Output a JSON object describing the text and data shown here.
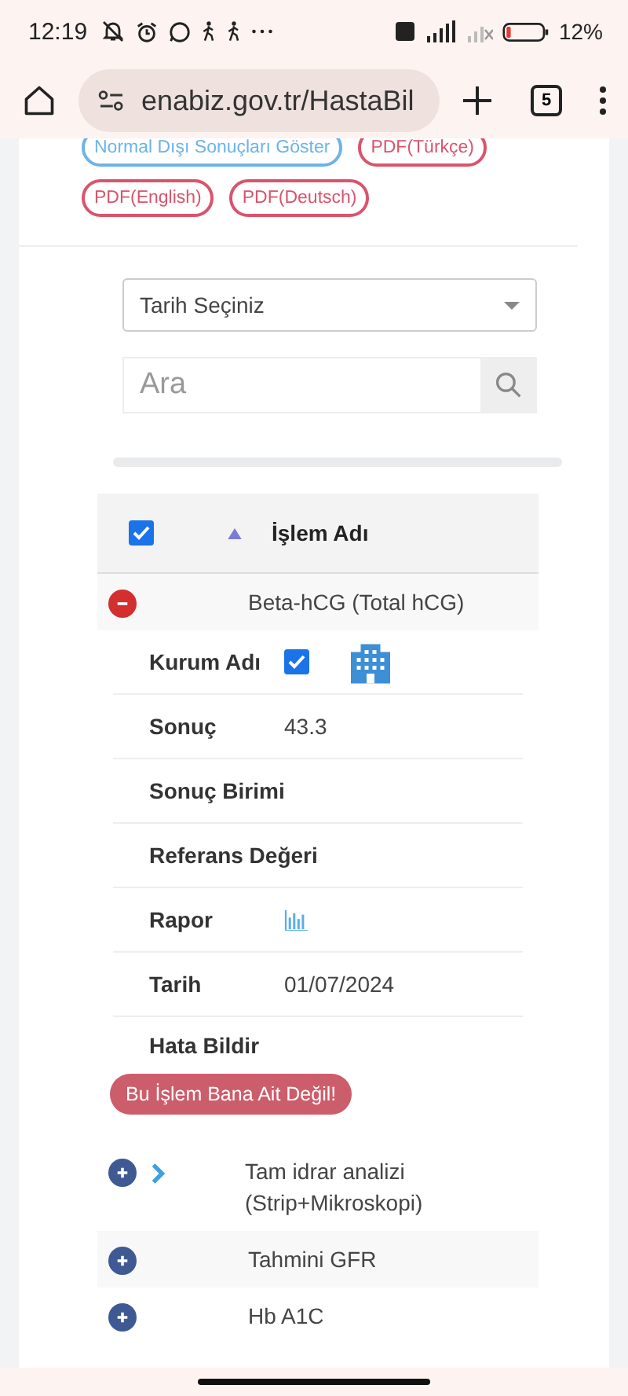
{
  "status_bar": {
    "time": "12:19",
    "battery": "12%"
  },
  "browser": {
    "url": "enabiz.gov.tr/HastaBil",
    "tab_count": "5"
  },
  "filter_buttons": [
    {
      "label": "Normal Dışı Sonuçları Göster",
      "kind": "blue"
    },
    {
      "label": "PDF(Türkçe)",
      "kind": "red"
    },
    {
      "label": "PDF(English)",
      "kind": "red"
    },
    {
      "label": "PDF(Deutsch)",
      "kind": "red"
    }
  ],
  "date_select": {
    "value": "Tarih Seçiniz"
  },
  "search": {
    "placeholder": "Ara"
  },
  "table": {
    "header": {
      "checked": true,
      "column": "İşlem Adı"
    },
    "rows": [
      {
        "name": "Beta-hCG (Total hCG)",
        "expanded": true,
        "chevron": false,
        "details": [
          {
            "kind": "institution",
            "label": "Kurum Adı",
            "checked": true
          },
          {
            "kind": "text",
            "label": "Sonuç",
            "value": "43.3"
          },
          {
            "kind": "text",
            "label": "Sonuç Birimi"
          },
          {
            "kind": "text",
            "label": "Referans Değeri"
          },
          {
            "kind": "report",
            "label": "Rapor"
          },
          {
            "kind": "text",
            "label": "Tarih",
            "value": "01/07/2024"
          },
          {
            "kind": "report_error",
            "label": "Hata Bildir",
            "button": "Bu İşlem Bana Ait Değil!"
          }
        ]
      },
      {
        "name": "Tam idrar analizi (Strip+Mikroskopi)",
        "expanded": false,
        "chevron": true
      },
      {
        "name": "Tahmini GFR",
        "expanded": false,
        "chevron": false
      },
      {
        "name": "Hb A1C",
        "expanded": false,
        "chevron": false
      }
    ]
  }
}
